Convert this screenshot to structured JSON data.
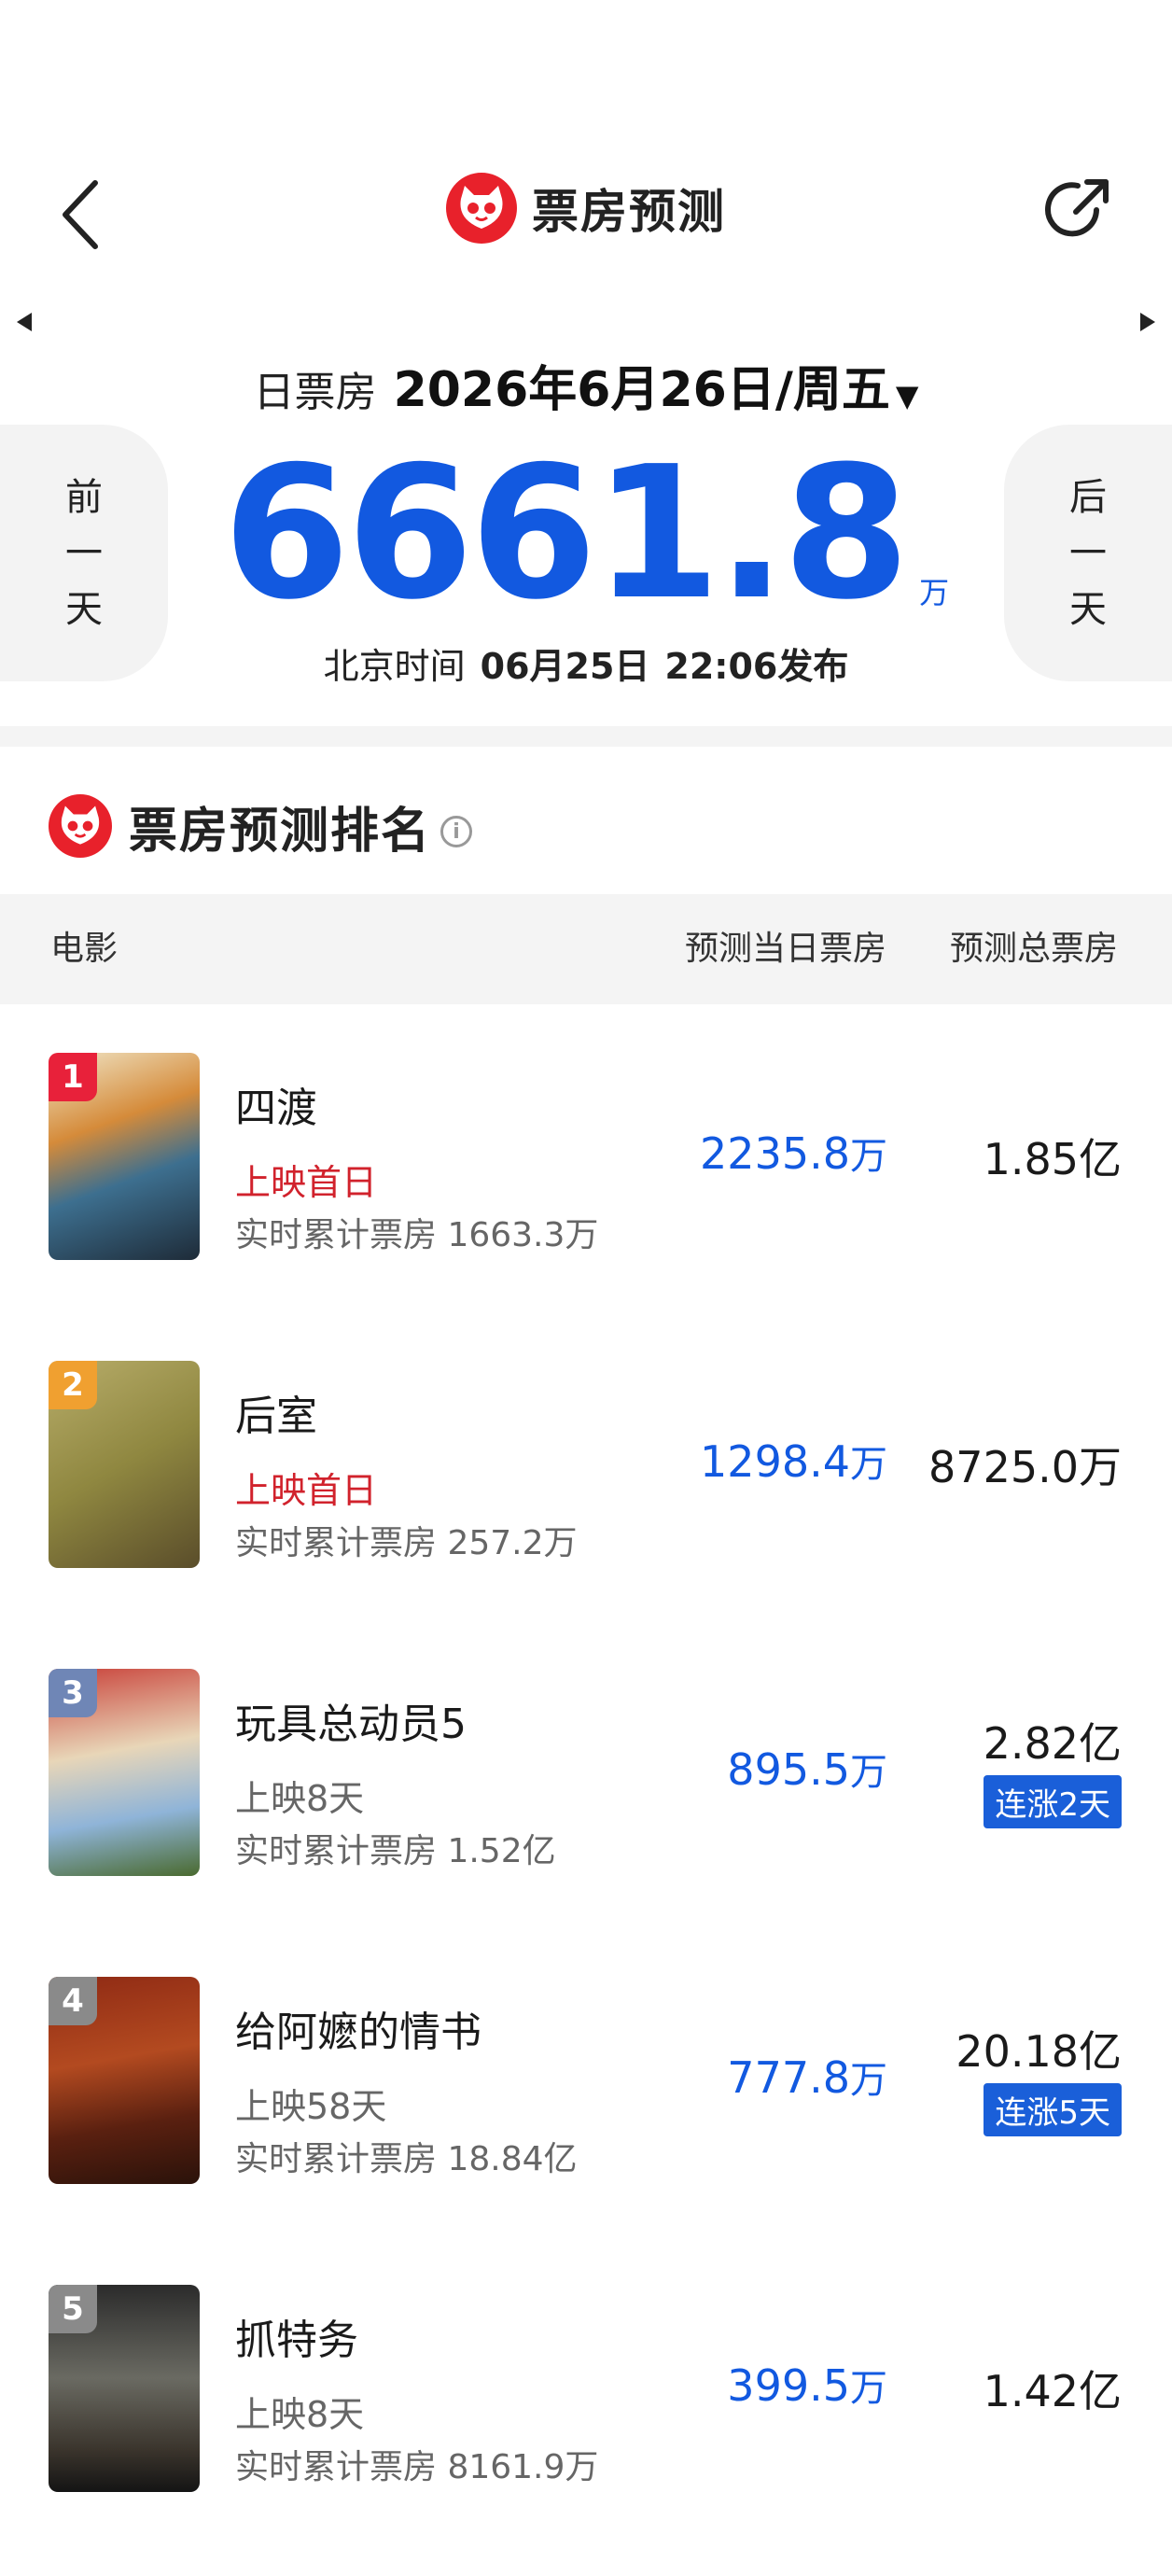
{
  "header": {
    "title": "票房预测",
    "back_icon": "chevron-left-icon",
    "share_icon": "share-icon",
    "logo_icon": "cat-logo-icon"
  },
  "summary": {
    "date_label": "日票房",
    "date_value": "2026年6月26日/周五",
    "value": "6661.8",
    "unit": "万",
    "publish_prefix": "北京时间",
    "publish_date": "06月25日",
    "publish_time": "22:06发布",
    "prev_day_chars": [
      "前",
      "一",
      "天"
    ],
    "next_day_chars": [
      "后",
      "一",
      "天"
    ]
  },
  "ranking": {
    "title": "票房预测排名",
    "columns": {
      "movie": "电影",
      "today": "预测当日票房",
      "total": "预测总票房"
    },
    "rows": [
      {
        "rank": "1",
        "badge_color": "#e8213a",
        "title": "四渡",
        "release": "上映首日",
        "release_red": true,
        "cumulative": "实时累计票房 1663.3万",
        "today_value": "2235.8",
        "today_unit": "万",
        "total_value": "1.85",
        "total_unit": "亿",
        "rise_badge": ""
      },
      {
        "rank": "2",
        "badge_color": "#f0a030",
        "title": "后室",
        "release": "上映首日",
        "release_red": true,
        "cumulative": "实时累计票房 257.2万",
        "today_value": "1298.4",
        "today_unit": "万",
        "total_value": "8725.0",
        "total_unit": "万",
        "rise_badge": ""
      },
      {
        "rank": "3",
        "badge_color": "#6f86b6",
        "title": "玩具总动员5",
        "release": "上映8天",
        "release_red": false,
        "cumulative": "实时累计票房 1.52亿",
        "today_value": "895.5",
        "today_unit": "万",
        "total_value": "2.82",
        "total_unit": "亿",
        "rise_badge": "连涨2天"
      },
      {
        "rank": "4",
        "badge_color": "#8a8a8a",
        "title": "给阿嬷的情书",
        "release": "上映58天",
        "release_red": false,
        "cumulative": "实时累计票房 18.84亿",
        "today_value": "777.8",
        "today_unit": "万",
        "total_value": "20.18",
        "total_unit": "亿",
        "rise_badge": "连涨5天"
      },
      {
        "rank": "5",
        "badge_color": "#8a8a8a",
        "title": "抓特务",
        "release": "上映8天",
        "release_red": false,
        "cumulative": "实时累计票房 8161.9万",
        "today_value": "399.5",
        "today_unit": "万",
        "total_value": "1.42",
        "total_unit": "亿",
        "rise_badge": ""
      }
    ]
  }
}
